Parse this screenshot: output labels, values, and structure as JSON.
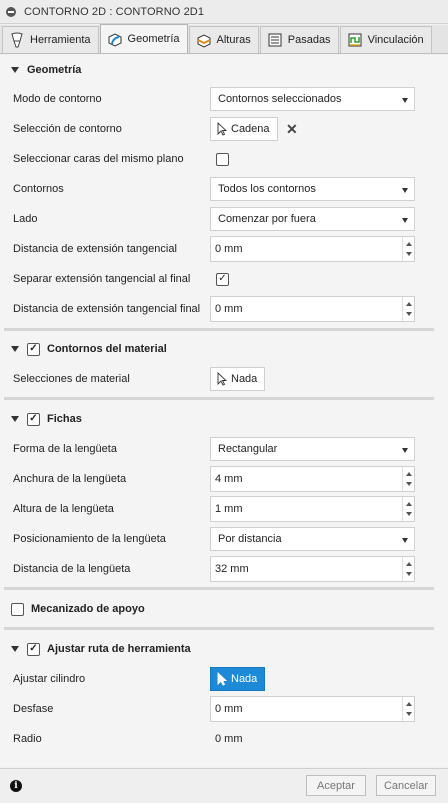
{
  "window": {
    "title": "CONTORNO 2D : CONTORNO 2D1"
  },
  "tabs": [
    {
      "label": "Herramienta",
      "icon": "tool-icon"
    },
    {
      "label": "Geometría",
      "icon": "geometry-icon"
    },
    {
      "label": "Alturas",
      "icon": "heights-icon"
    },
    {
      "label": "Pasadas",
      "icon": "passes-icon"
    },
    {
      "label": "Vinculación",
      "icon": "linking-icon"
    }
  ],
  "active_tab": "Geometría",
  "geometria": {
    "title": "Geometría",
    "modo_contorno": {
      "label": "Modo de contorno",
      "value": "Contornos seleccionados"
    },
    "seleccion_contorno": {
      "label": "Selección de contorno",
      "button": "Cadena"
    },
    "seleccionar_caras": {
      "label": "Seleccionar caras del mismo plano",
      "checked": false
    },
    "contornos": {
      "label": "Contornos",
      "value": "Todos los contornos"
    },
    "lado": {
      "label": "Lado",
      "value": "Comenzar por fuera"
    },
    "dist_ext_tangencial": {
      "label": "Distancia de extensión tangencial",
      "value": "0 mm"
    },
    "separar_ext": {
      "label": "Separar extensión tangencial al final",
      "checked": true
    },
    "dist_ext_final": {
      "label": "Distancia de extensión tangencial final",
      "value": "0 mm"
    }
  },
  "contornos_material": {
    "title": "Contornos del material",
    "checked": true,
    "selecciones": {
      "label": "Selecciones de material",
      "button": "Nada"
    }
  },
  "fichas": {
    "title": "Fichas",
    "checked": true,
    "forma": {
      "label": "Forma de la lengüeta",
      "value": "Rectangular"
    },
    "anchura": {
      "label": "Anchura de la lengüeta",
      "value": "4 mm"
    },
    "altura": {
      "label": "Altura de la lengüeta",
      "value": "1 mm"
    },
    "posicionamiento": {
      "label": "Posicionamiento de la lengüeta",
      "value": "Por distancia"
    },
    "distancia": {
      "label": "Distancia de la lengüeta",
      "value": "32 mm"
    }
  },
  "mecanizado_apoyo": {
    "title": "Mecanizado de apoyo",
    "checked": false
  },
  "ajustar_ruta": {
    "title": "Ajustar ruta de herramienta",
    "checked": true,
    "ajustar_cilindro": {
      "label": "Ajustar cilindro",
      "button": "Nada"
    },
    "desfase": {
      "label": "Desfase",
      "value": "0 mm"
    },
    "radio": {
      "label": "Radio",
      "value": "0 mm"
    }
  },
  "footer": {
    "ok": "Aceptar",
    "cancel": "Cancelar"
  },
  "colors": {
    "accent": "#1d8ad8",
    "panel": "#f4f4f4"
  }
}
